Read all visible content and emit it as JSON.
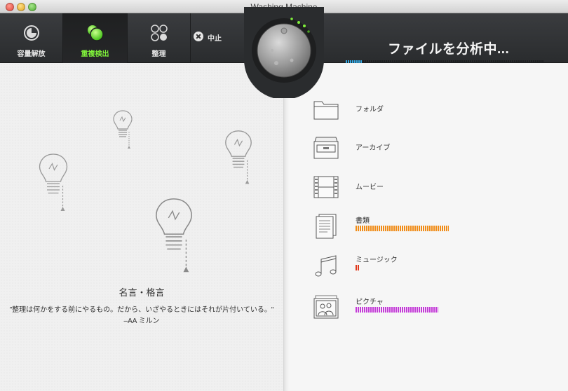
{
  "window": {
    "title": "Washing Machine"
  },
  "toolbar": {
    "tabs": [
      {
        "label": "容量解放",
        "icon": "pie-chart-icon"
      },
      {
        "label": "重複検出",
        "icon": "duplicate-bubbles-icon",
        "active": true
      },
      {
        "label": "整理",
        "icon": "organize-grid-icon"
      }
    ],
    "stop_label": "中止",
    "status": "ファイルを分析中...",
    "progress_fraction": 0.08
  },
  "quote": {
    "title": "名言・格言",
    "text": "\"整理は何かをする前にやるもの。だから、いざやるときにはそれが片付いている。\" –AA ミルン"
  },
  "categories": [
    {
      "label": "フォルダ",
      "icon": "folder-icon"
    },
    {
      "label": "アーカイブ",
      "icon": "archive-box-icon"
    },
    {
      "label": "ムービー",
      "icon": "film-strip-icon"
    },
    {
      "label": "書類",
      "icon": "document-icon",
      "bar_color": "#f08c18",
      "bar_fraction": 0.9
    },
    {
      "label": "ミュージック",
      "icon": "music-notes-icon",
      "bar_color": "#e0391c",
      "bar_fraction": 0.04
    },
    {
      "label": "ピクチャ",
      "icon": "picture-icon",
      "bar_color": "#c43bd8",
      "bar_fraction": 0.8
    }
  ],
  "colors": {
    "accent_green": "#7ff03a",
    "progress_blue": "#34a7e0"
  }
}
